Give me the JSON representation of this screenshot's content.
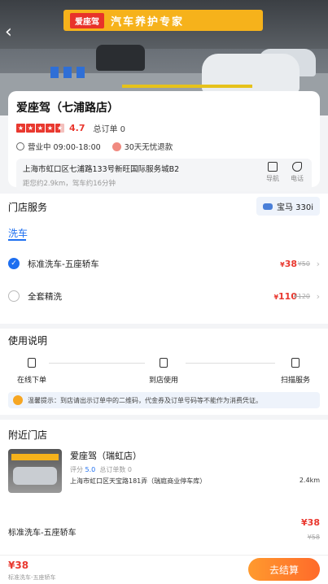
{
  "store": {
    "name": "爱座驾（七浦路店）",
    "rating": "4.7",
    "orders": "总订单 0",
    "hours": "营业中 09:00-18:00",
    "refund": "30天无忧退款",
    "address": "上海市虹口区七浦路133号新旺国际服务城B2",
    "distance": "距您约2.9km，驾车约16分钟",
    "nav_label": "导航",
    "phone_label": "电话"
  },
  "hero": {
    "sign_logo": "爱座驾",
    "sign_text": "汽车养护专家"
  },
  "services": {
    "heading": "门店服务",
    "car": "宝马 330i",
    "tab": "洗车",
    "items": [
      {
        "name": "标准洗车-五座轿车",
        "price": "38",
        "original": "¥50",
        "selected": true
      },
      {
        "name": "全套精洗",
        "price": "110",
        "original": "¥120",
        "selected": false
      }
    ]
  },
  "instructions": {
    "heading": "使用说明",
    "steps": [
      "在线下单",
      "到店使用",
      "扫描服务"
    ],
    "tip": "温馨提示：到店请出示订单中的二维码，代金券及订单号码等不能作为消费凭证。"
  },
  "nearby": {
    "heading": "附近门店",
    "name": "爱座驾（瑞虹店）",
    "score_label": "评分",
    "score": "5.0",
    "orders": "总订单数 0",
    "address": "上海市虹口区天宝路181弄（瑞庭商业停车库）",
    "distance": "2.4km",
    "service": "标准洗车-五座轿车",
    "price": "¥38",
    "original": "¥58"
  },
  "bottom": {
    "total": "¥38",
    "sub": "标准洗车-五座轿车",
    "checkout": "去结算"
  },
  "colors": {
    "accent": "#1e6ff0",
    "price": "#e9382f",
    "checkout": "#ff7a2a"
  }
}
